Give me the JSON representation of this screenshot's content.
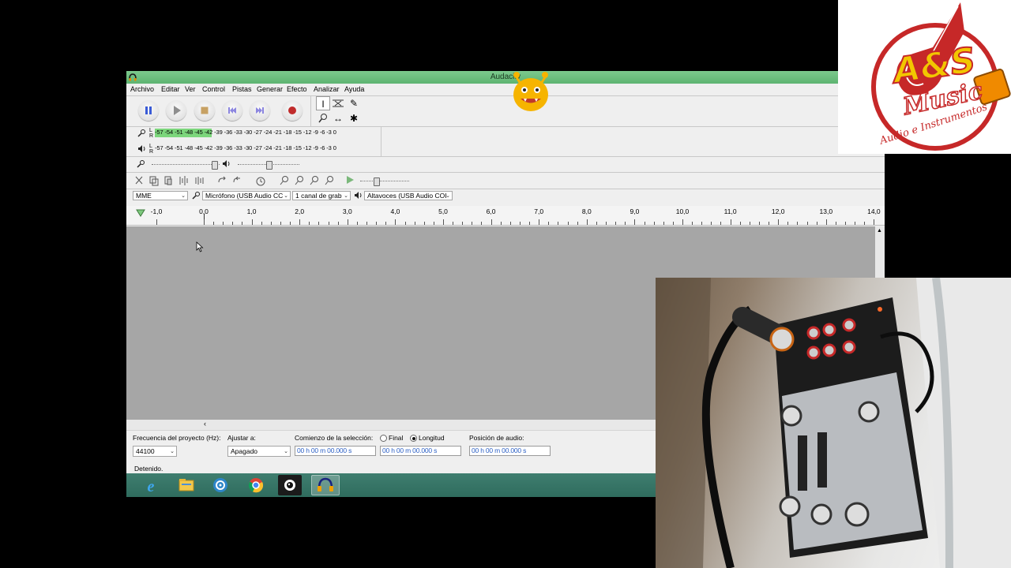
{
  "window": {
    "title": "Audacity"
  },
  "menu": [
    "Archivo",
    "Editar",
    "Ver",
    "Control",
    "Pistas",
    "Generar",
    "Efecto",
    "Analizar",
    "Ayuda"
  ],
  "meters": {
    "rec_scale": "-57 -54 -51 -48 -45 -42 -39 -36 -33 -30 -27 -24 -21 -18 -15 -12  -9  -6  -3  0",
    "play_scale": "-57 -54 -51 -48 -45 -42 -39 -36 -33 -30 -27 -24 -21 -18 -15 -12  -9  -6  -3  0",
    "L": "L",
    "R": "R"
  },
  "device": {
    "host": "MME",
    "recording": "Micrófono (USB Audio CC",
    "channels": "1 canal de grab",
    "playback": "Altavoces (USB Audio COI"
  },
  "ruler": {
    "ticks": [
      "-1,0",
      "0,0",
      "1,0",
      "2,0",
      "3,0",
      "4,0",
      "5,0",
      "6,0",
      "7,0",
      "8,0",
      "9,0",
      "10,0",
      "11,0",
      "12,0",
      "13,0",
      "14,0"
    ]
  },
  "selection": {
    "rate_label": "Frecuencia del proyecto (Hz):",
    "rate_value": "44100",
    "snap_label": "Ajustar a:",
    "snap_value": "Apagado",
    "start_label": "Comienzo de la selección:",
    "end_option": "Final",
    "length_option": "Longitud",
    "start_time": "00 h 00 m 00.000 s",
    "length_time": "00 h 00 m 00.000 s",
    "audio_pos_label": "Posición de audio:",
    "audio_pos_time": "00 h 00 m 00.000 s"
  },
  "status": "Detenido.",
  "taskbar": [
    "internet-explorer-icon",
    "file-explorer-icon",
    "media-icon",
    "chrome-icon",
    "camera-app-icon",
    "audacity-icon"
  ],
  "logo": {
    "line1": "A&S",
    "line2": "Music",
    "line3": "Audio e Instrumentos"
  },
  "colors": {
    "titlebar": "#6cbd7e",
    "taskbar": "#367464",
    "track_bg": "#a6a6a6",
    "logo_red": "#d42020",
    "logo_yellow": "#f2c600"
  }
}
